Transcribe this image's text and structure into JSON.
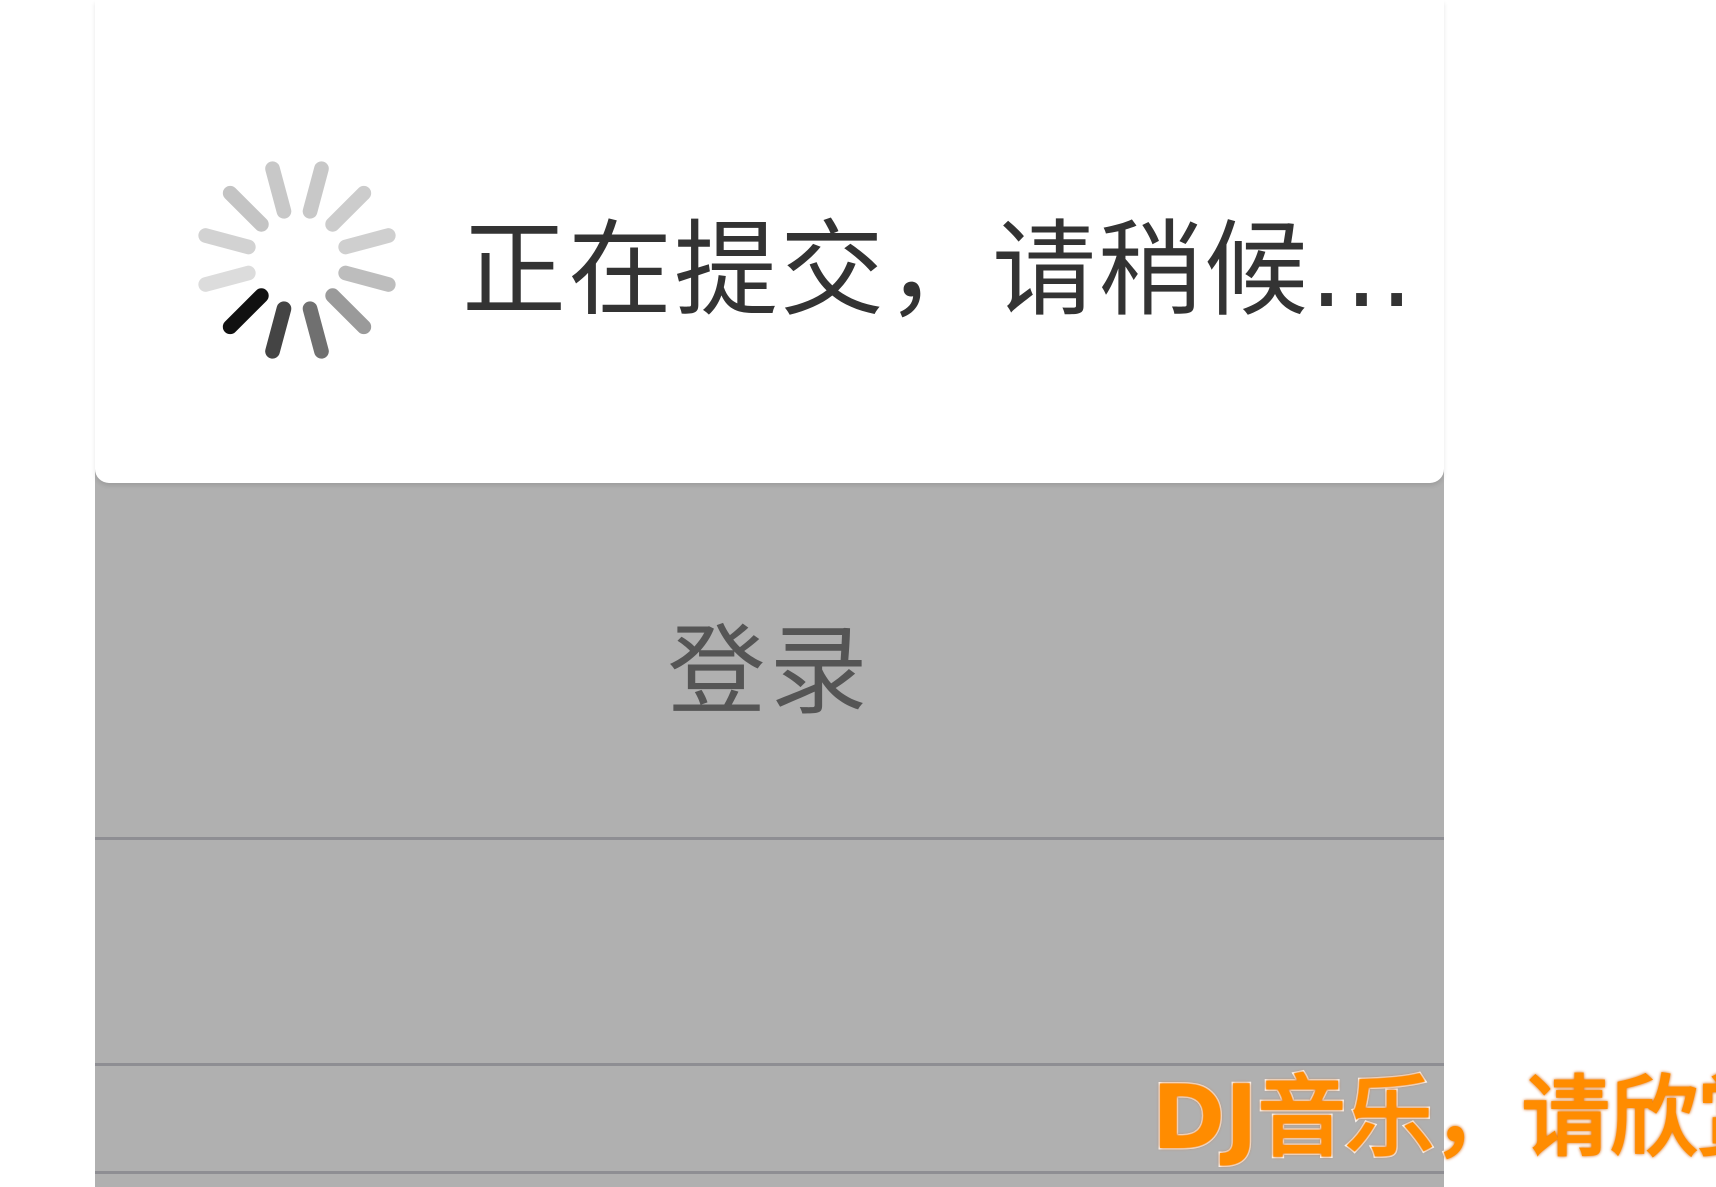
{
  "loading": {
    "message": "正在提交，请稍候...",
    "icon": "spinner-icon"
  },
  "login": {
    "label": "登录"
  },
  "watermark": {
    "text": "DJ音乐，请欣赏"
  },
  "colors": {
    "panel_bg": "#b0b0b0",
    "divider": "#8e8e93",
    "text_dark": "#333333",
    "button_text": "#555555",
    "watermark": "#ff8c00"
  }
}
